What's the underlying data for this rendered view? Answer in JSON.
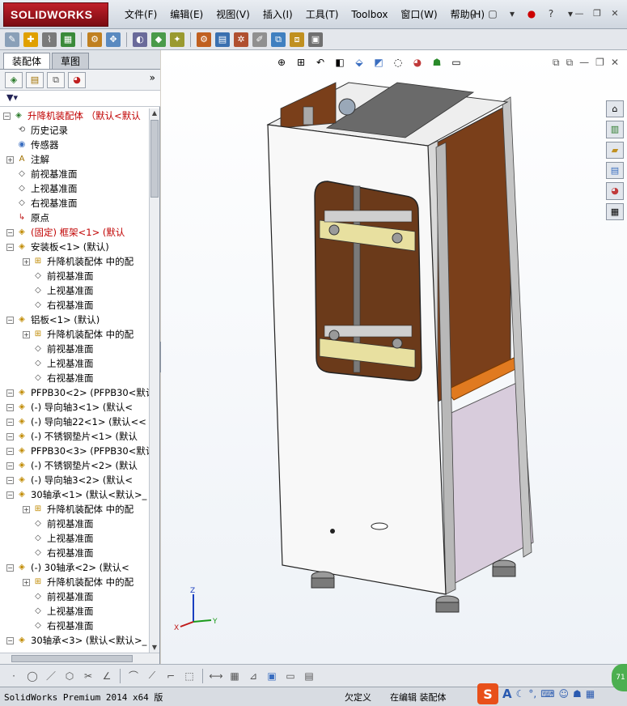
{
  "app": {
    "logo_text": "SOLIDWORKS"
  },
  "menu": [
    "文件(F)",
    "编辑(E)",
    "视图(V)",
    "插入(I)",
    "工具(T)",
    "Toolbox",
    "窗口(W)",
    "帮助(H)"
  ],
  "panel": {
    "tabs": [
      "装配体",
      "草图"
    ],
    "active_tab": "草图",
    "more": "»"
  },
  "tree": {
    "items": [
      {
        "label": "升降机装配体  （默认<默认",
        "icon": "assembly-icon",
        "level": 0,
        "red": true
      },
      {
        "label": "历史记录",
        "icon": "history-icon",
        "level": 1
      },
      {
        "label": "传感器",
        "icon": "sensor-icon",
        "level": 1
      },
      {
        "label": "注解",
        "icon": "annotation-icon",
        "level": 1
      },
      {
        "label": "前视基准面",
        "icon": "plane-icon",
        "level": 1
      },
      {
        "label": "上视基准面",
        "icon": "plane-icon",
        "level": 1
      },
      {
        "label": "右视基准面",
        "icon": "plane-icon",
        "level": 1
      },
      {
        "label": "原点",
        "icon": "origin-icon",
        "level": 1
      },
      {
        "label": "(固定) 框架<1> (默认",
        "icon": "part-icon",
        "level": 1,
        "red": true
      },
      {
        "label": "安装板<1> (默认)",
        "icon": "part-icon",
        "level": 1
      },
      {
        "label": "升降机装配体 中的配",
        "icon": "mates-icon",
        "level": 2
      },
      {
        "label": "前视基准面",
        "icon": "plane-icon",
        "level": 2
      },
      {
        "label": "上视基准面",
        "icon": "plane-icon",
        "level": 2
      },
      {
        "label": "右视基准面",
        "icon": "plane-icon",
        "level": 2
      },
      {
        "label": "铝板<1> (默认)",
        "icon": "part-icon",
        "level": 1
      },
      {
        "label": "升降机装配体 中的配",
        "icon": "mates-icon",
        "level": 2
      },
      {
        "label": "前视基准面",
        "icon": "plane-icon",
        "level": 2
      },
      {
        "label": "上视基准面",
        "icon": "plane-icon",
        "level": 2
      },
      {
        "label": "右视基准面",
        "icon": "plane-icon",
        "level": 2
      },
      {
        "label": "PFPB30<2> (PFPB30<默认",
        "icon": "part-icon",
        "level": 1
      },
      {
        "label": "(-) 导向轴3<1> (默认<",
        "icon": "part-icon",
        "level": 1
      },
      {
        "label": "(-) 导向轴22<1> (默认<<",
        "icon": "part-icon",
        "level": 1
      },
      {
        "label": "(-) 不锈钢垫片<1> (默认",
        "icon": "part-icon",
        "level": 1
      },
      {
        "label": "PFPB30<3> (PFPB30<默认",
        "icon": "part-icon",
        "level": 1
      },
      {
        "label": "(-) 不锈钢垫片<2> (默认",
        "icon": "part-icon",
        "level": 1
      },
      {
        "label": "(-) 导向轴3<2> (默认<",
        "icon": "part-icon",
        "level": 1
      },
      {
        "label": "30轴承<1> (默认<默认>_",
        "icon": "part-icon",
        "level": 1
      },
      {
        "label": "升降机装配体 中的配",
        "icon": "mates-icon",
        "level": 2
      },
      {
        "label": "前视基准面",
        "icon": "plane-icon",
        "level": 2
      },
      {
        "label": "上视基准面",
        "icon": "plane-icon",
        "level": 2
      },
      {
        "label": "右视基准面",
        "icon": "plane-icon",
        "level": 2
      },
      {
        "label": "(-) 30轴承<2> (默认<",
        "icon": "part-icon",
        "level": 1
      },
      {
        "label": "升降机装配体 中的配",
        "icon": "mates-icon",
        "level": 2
      },
      {
        "label": "前视基准面",
        "icon": "plane-icon",
        "level": 2
      },
      {
        "label": "上视基准面",
        "icon": "plane-icon",
        "level": 2
      },
      {
        "label": "右视基准面",
        "icon": "plane-icon",
        "level": 2
      },
      {
        "label": "30轴承<3> (默认<默认>_",
        "icon": "part-icon",
        "level": 1
      }
    ]
  },
  "triad": {
    "x": "X",
    "y": "Y",
    "z": "Z"
  },
  "status": {
    "left": "SolidWorks Premium 2014 x64 版",
    "definition": "欠定义",
    "mode": "在编辑 装配体"
  },
  "ime": {
    "logo": "S",
    "mode": "A"
  },
  "badge": "71"
}
